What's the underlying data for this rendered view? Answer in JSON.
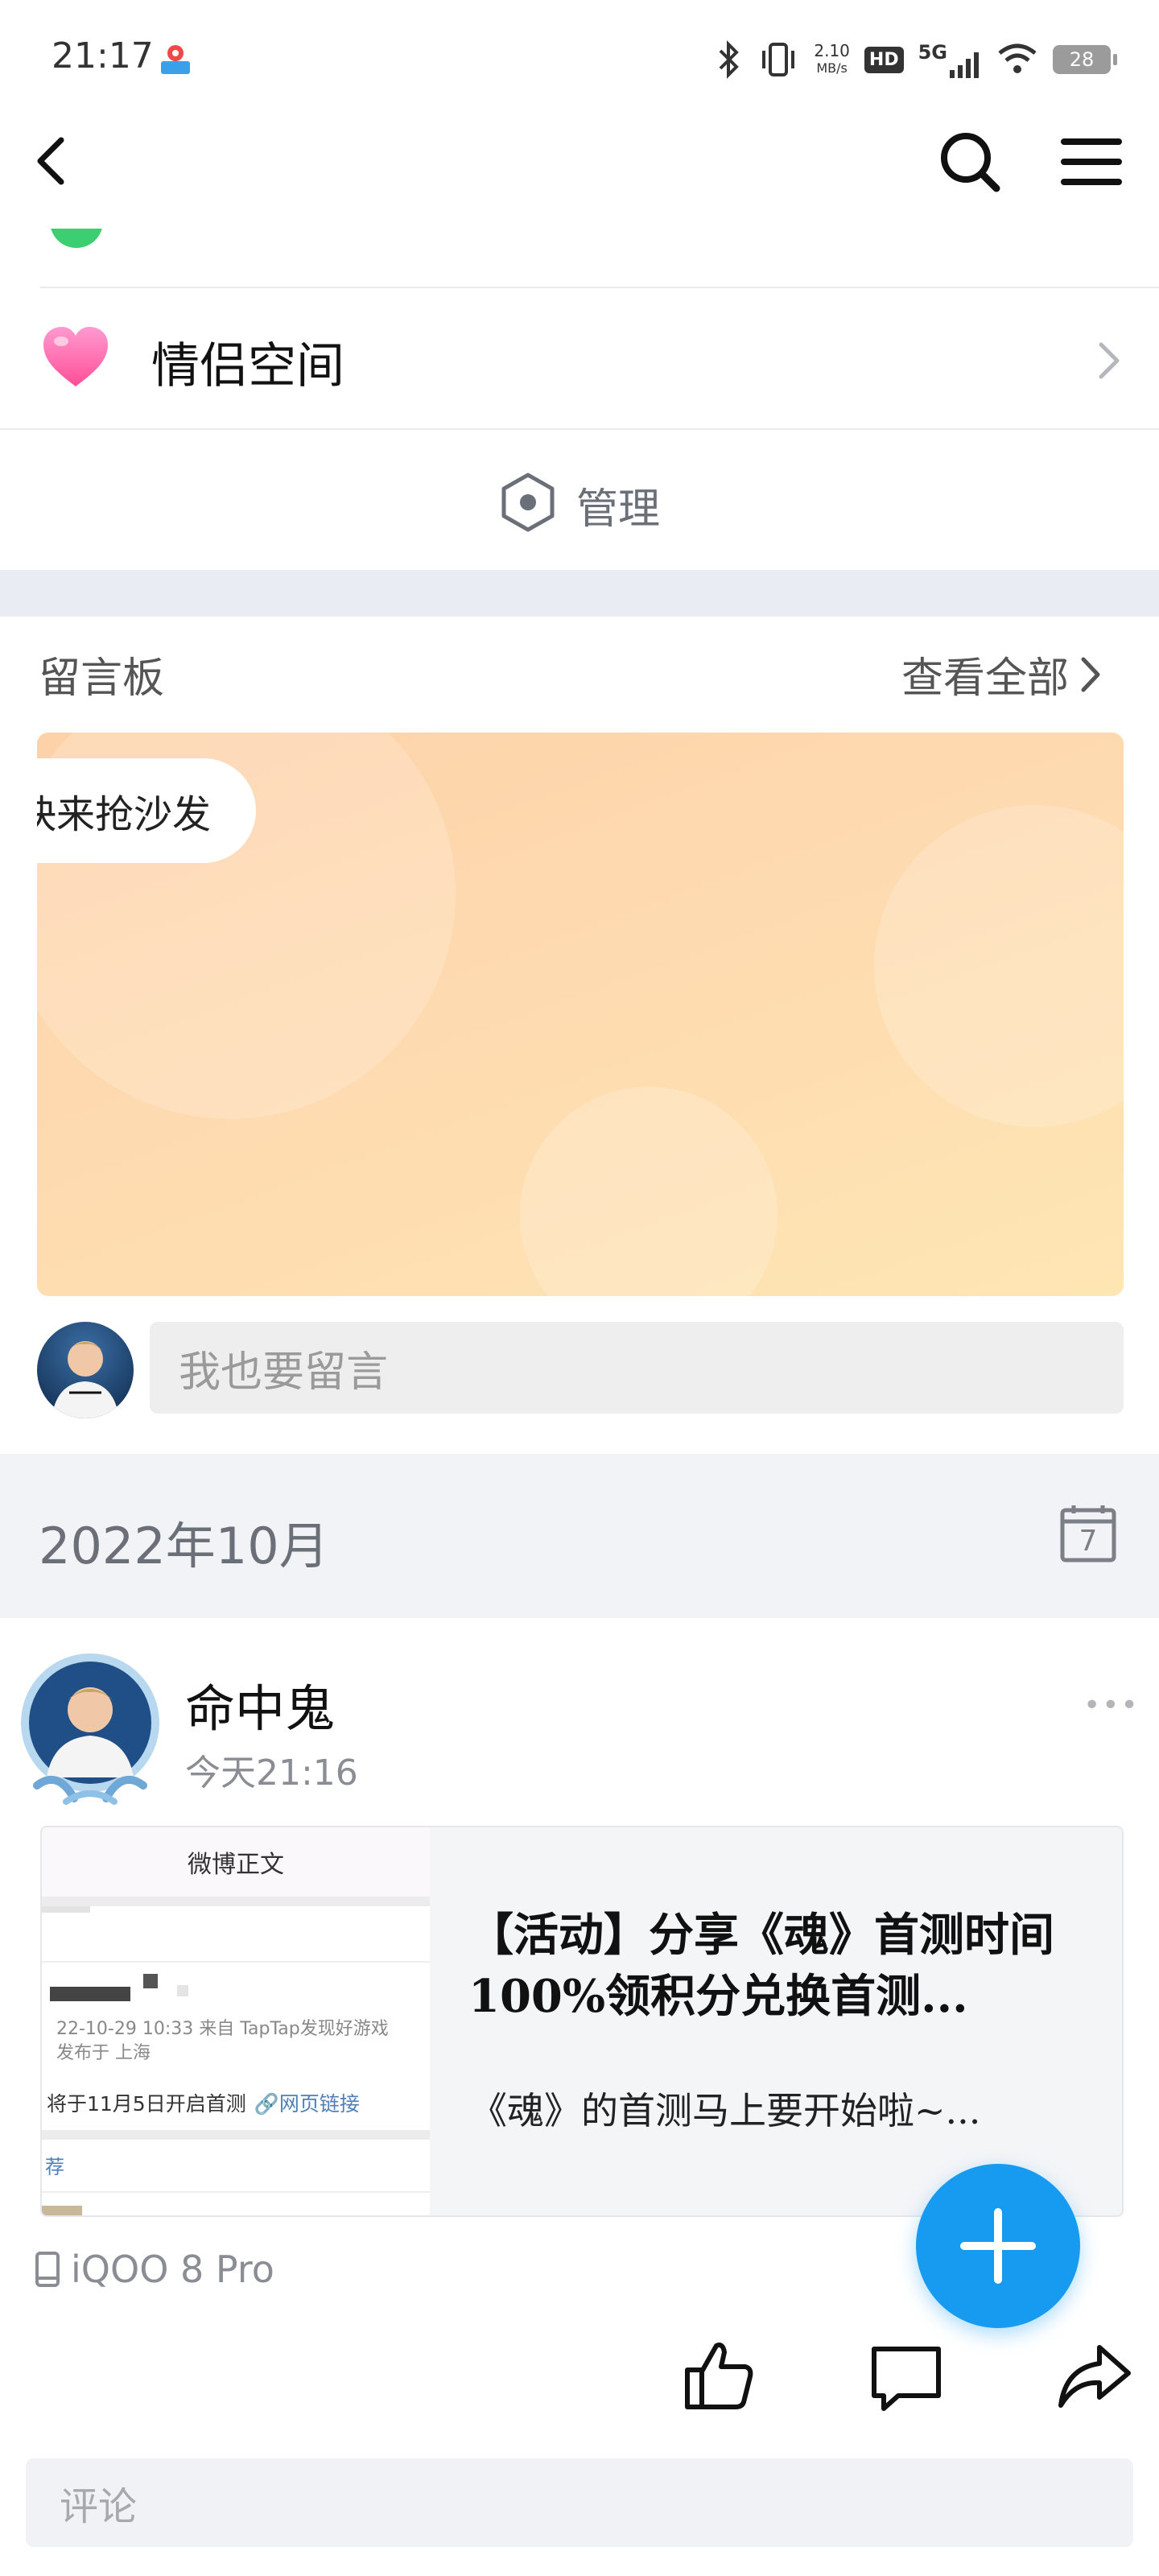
{
  "status_bar": {
    "time": "21:17",
    "net_speed_value": "2.10",
    "net_speed_unit": "MB/s",
    "hd": "HD",
    "network": "5G",
    "battery": "28"
  },
  "rows": {
    "couple_space": "情侣空间",
    "manage": "管理"
  },
  "message_board": {
    "title": "留言板",
    "view_all": "查看全部",
    "sofa_text": "快来抢沙发",
    "input_placeholder": "我也要留言"
  },
  "month": {
    "label": "2022年10月",
    "calendar_day": "7"
  },
  "post": {
    "author": "命中鬼",
    "time": "今天21:16",
    "more": "•••",
    "device": "iQOO 8 Pro",
    "comment_placeholder": "评论",
    "link": {
      "title": "【活动】分享《魂》首测时间 100%领积分兑换首测...",
      "desc": "《魂》的首测马上要开始啦~...",
      "thumb_header": "微博正文",
      "thumb_meta": "22-10-29 10:33  来自 TapTap发现好游戏",
      "thumb_loc": "发布于 上海",
      "thumb_line": "将于11月5日开启首测",
      "thumb_link": "网页链接",
      "thumb_rec": "荐"
    }
  },
  "colors": {
    "accent_blue": "#169bf0",
    "section_gray": "#e9ecf2",
    "heart_pink": "#ff6fae"
  }
}
